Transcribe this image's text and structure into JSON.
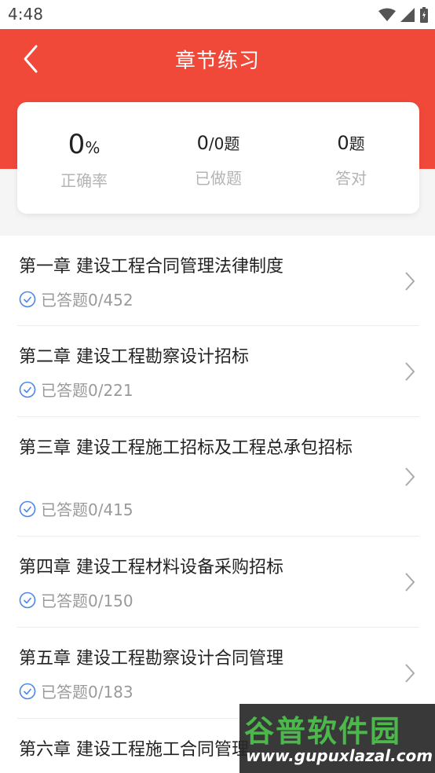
{
  "status_bar": {
    "time": "4:48"
  },
  "header": {
    "title": "章节练习"
  },
  "stats": {
    "accuracy_value": "0",
    "accuracy_unit": "%",
    "accuracy_label": "正确率",
    "done_value": "0",
    "done_total": "/0题",
    "done_label": "已做题",
    "correct_value": "0",
    "correct_unit": "题",
    "correct_label": "答对"
  },
  "chapters": [
    {
      "title": "第一章 建设工程合同管理法律制度",
      "progress": "已答题0/452"
    },
    {
      "title": "第二章 建设工程勘察设计招标",
      "progress": "已答题0/221"
    },
    {
      "title": "第三章 建设工程施工招标及工程总承包招标",
      "progress": "已答题0/415"
    },
    {
      "title": "第四章 建设工程材料设备采购招标",
      "progress": "已答题0/150"
    },
    {
      "title": "第五章 建设工程勘察设计合同管理",
      "progress": "已答题0/183"
    },
    {
      "title": "第六章 建设工程施工合同管理",
      "progress": ""
    }
  ],
  "watermark": {
    "brand": "谷普软件园",
    "url": "www.gupuxlazal.com"
  },
  "colors": {
    "primary": "#f0493a",
    "check": "#4a86e8"
  }
}
